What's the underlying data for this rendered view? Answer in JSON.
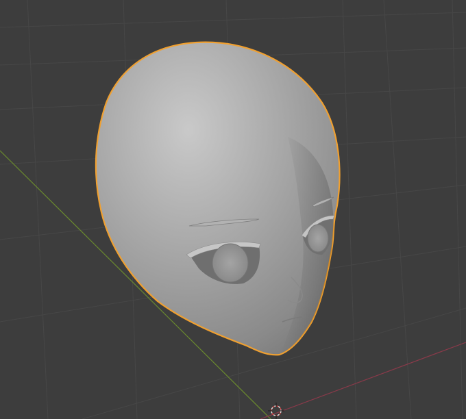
{
  "viewport": {
    "mode": "solid-shading",
    "background_color": "#3d3d3d",
    "grid_color": "#4a4a4a",
    "x_axis_color": "#8a3a4a",
    "y_axis_color": "#6a8a2e",
    "selection_outline_color": "#f0a030",
    "mesh_color": "#9c9c9c"
  },
  "selected_object": {
    "icon": "head-mesh-icon",
    "selected": true
  },
  "origin_marker": {
    "icon": "3d-cursor-icon"
  }
}
